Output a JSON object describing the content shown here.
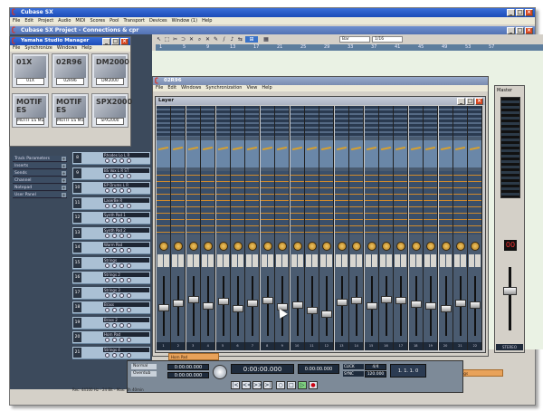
{
  "main_window": {
    "title": "Cubase SX",
    "menu": [
      "File",
      "Edit",
      "Project",
      "Audio",
      "MIDI",
      "Scores",
      "Pool",
      "Transport",
      "Devices",
      "Window (1)",
      "Help"
    ]
  },
  "project_window": {
    "title": "Cubase SX Project - Connections & cpr",
    "toolbar": {
      "combo1": "Bar",
      "combo2": "1/16"
    },
    "ruler": [
      "1",
      "5",
      "9",
      "13",
      "17",
      "21",
      "25",
      "29",
      "33",
      "37",
      "41",
      "45",
      "49",
      "53",
      "57"
    ]
  },
  "studio_manager": {
    "title": "Yamaha Studio Manager",
    "menu": [
      "File",
      "Synchronize",
      "Windows",
      "Help"
    ],
    "devices": [
      {
        "tag": "01X",
        "label": "01X"
      },
      {
        "tag": "02R96",
        "label": "02R96"
      },
      {
        "tag": "DM2000",
        "label": "DM2000"
      },
      {
        "tag": "MOTIF ES",
        "label": "MOTIF ES Multi"
      },
      {
        "tag": "MOTIF ES",
        "label": "MOTIF ES Mixed"
      },
      {
        "tag": "SPX2000",
        "label": "SPX2000"
      }
    ]
  },
  "inspector": {
    "sections": [
      "Track Parameters",
      "Inserts",
      "Sends",
      "Channel",
      "Notepad",
      "User Panel"
    ]
  },
  "tracks": [
    {
      "num": "8",
      "name": "Rhodes Lo L R"
    },
    {
      "num": "9",
      "name": "BS Vox L R ST"
    },
    {
      "num": "10",
      "name": "EP Drums L R"
    },
    {
      "num": "11",
      "name": "LaserBe R"
    },
    {
      "num": "12",
      "name": "Synth Pad 1"
    },
    {
      "num": "13",
      "name": "Synth Pad 2"
    },
    {
      "num": "14",
      "name": "Warm Pad"
    },
    {
      "num": "15",
      "name": "Strings"
    },
    {
      "num": "16",
      "name": "Strings 2"
    },
    {
      "num": "17",
      "name": "Strings 3"
    },
    {
      "num": "18",
      "name": "Brass"
    },
    {
      "num": "19",
      "name": "Brass 2"
    },
    {
      "num": "20",
      "name": "Horn Pad"
    },
    {
      "num": "21",
      "name": "Strings 4"
    }
  ],
  "mixer_window": {
    "title": "02R96",
    "menu": [
      "File",
      "Edit",
      "Windows",
      "Synchronization",
      "View",
      "Help"
    ],
    "layer_title": "Layer",
    "channels": [
      "1",
      "2",
      "3",
      "4",
      "5",
      "6",
      "7",
      "8",
      "9",
      "10",
      "11",
      "12",
      "13",
      "14",
      "15",
      "16",
      "17",
      "18",
      "19",
      "20",
      "21",
      "22"
    ],
    "fader_levels": [
      0.47,
      0.55,
      0.62,
      0.5,
      0.58,
      0.44,
      0.55,
      0.6,
      0.48,
      0.52,
      0.42,
      0.35,
      0.57,
      0.6,
      0.5,
      0.62,
      0.6,
      0.54,
      0.5,
      0.44,
      0.56,
      0.52
    ]
  },
  "master": {
    "title": "Master",
    "solo_display": "00",
    "stereo_label": "STEREO"
  },
  "parts": [
    {
      "label": "Horn Pad"
    },
    {
      "label": "Strings"
    },
    {
      "label": "Strings"
    }
  ],
  "transport": {
    "time_top": "0:00:00.000",
    "time_mid": "0:00:00.000",
    "main_time": "0:00:00.000",
    "right_time": "0:00:00.000",
    "tempo": "120.000",
    "sig": "4/4",
    "click": "CLICK",
    "sync": "SYNC",
    "normal": "Normal",
    "overdub": "Overdub",
    "master_counter": "1. 1. 1. 0",
    "buttons": [
      "|<",
      "<<",
      ">>",
      ">|",
      "○",
      "□",
      "▷",
      "●"
    ]
  },
  "status": {
    "text": "Rec: 44100 Hz - 24 Bit - Max: 2h 40min"
  }
}
